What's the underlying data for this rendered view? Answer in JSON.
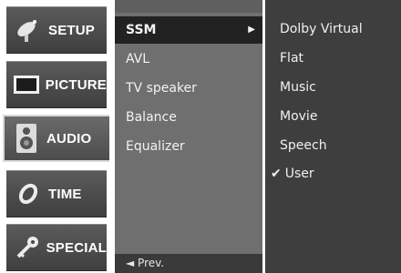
{
  "categories": [
    {
      "label": "SETUP",
      "icon": "satellite-dish-icon",
      "selected": false
    },
    {
      "label": "PICTURE",
      "icon": "monitor-icon",
      "selected": false
    },
    {
      "label": "AUDIO",
      "icon": "speaker-icon",
      "selected": true
    },
    {
      "label": "TIME",
      "icon": "clock-icon",
      "selected": false
    },
    {
      "label": "SPECIAL",
      "icon": "key-icon",
      "selected": false
    }
  ],
  "submenu": {
    "items": [
      {
        "label": "SSM",
        "selected": true,
        "arrow": "▶"
      },
      {
        "label": "AVL",
        "selected": false
      },
      {
        "label": "TV speaker",
        "selected": false
      },
      {
        "label": "Balance",
        "selected": false
      },
      {
        "label": "Equalizer",
        "selected": false
      }
    ],
    "prev_label": "◄ Prev."
  },
  "options": {
    "items": [
      {
        "label": "Dolby Virtual",
        "checked": false
      },
      {
        "label": "Flat",
        "checked": false
      },
      {
        "label": "Music",
        "checked": false
      },
      {
        "label": "Movie",
        "checked": false
      },
      {
        "label": "Speech",
        "checked": false
      },
      {
        "label": "User",
        "checked": true,
        "check_mark": "✔"
      }
    ]
  }
}
